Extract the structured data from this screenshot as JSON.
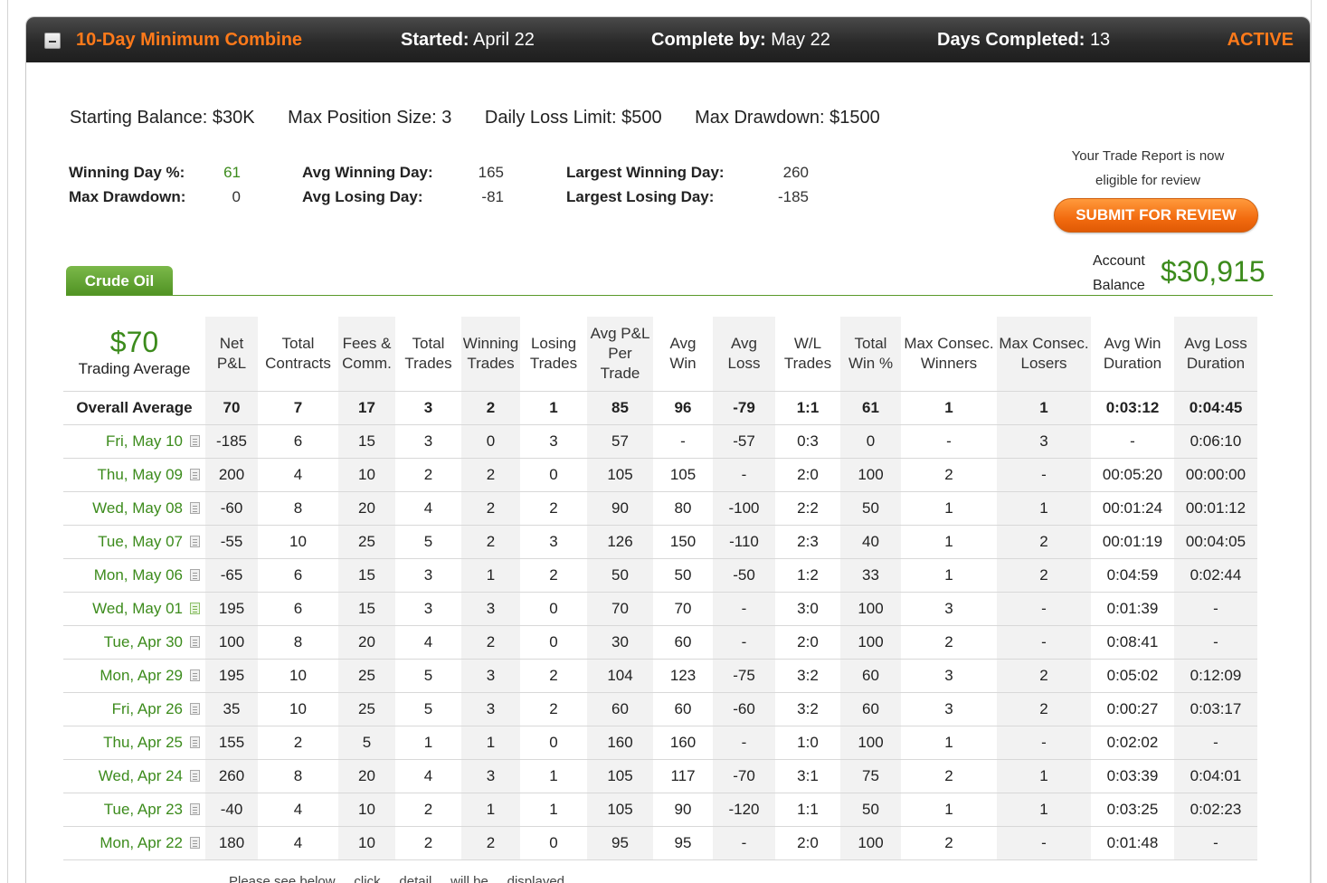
{
  "header": {
    "title": "10-Day Minimum Combine",
    "started_label": "Started:",
    "started_value": "April 22",
    "complete_label": "Complete by:",
    "complete_value": "May 22",
    "days_label": "Days Completed:",
    "days_value": "13",
    "status": "ACTIVE"
  },
  "rules": {
    "starting_balance": "Starting Balance: $30K",
    "max_position": "Max Position Size: 3",
    "daily_loss": "Daily Loss Limit: $500",
    "max_drawdown": "Max Drawdown: $1500"
  },
  "stats": {
    "winning_day_pct_label": "Winning Day %:",
    "winning_day_pct_value": "61",
    "max_drawdown_label": "Max Drawdown:",
    "max_drawdown_value": "0",
    "avg_winning_day_label": "Avg Winning Day:",
    "avg_winning_day_value": "165",
    "avg_losing_day_label": "Avg Losing Day:",
    "avg_losing_day_value": "-81",
    "largest_winning_day_label": "Largest Winning Day:",
    "largest_winning_day_value": "260",
    "largest_losing_day_label": "Largest Losing Day:",
    "largest_losing_day_value": "-185"
  },
  "review": {
    "note_line1": "Your Trade Report is now",
    "note_line2": "eligible for review",
    "submit_label": "SUBMIT FOR REVIEW"
  },
  "account": {
    "label_line1": "Account",
    "label_line2": "Balance",
    "value": "$30,915"
  },
  "tabs": [
    {
      "label": "Crude Oil"
    }
  ],
  "summary": {
    "trading_average_value": "$70",
    "trading_average_label": "Trading Average"
  },
  "columns": [
    {
      "l1": "Net",
      "l2": "P&L"
    },
    {
      "l1": "Total",
      "l2": "Contracts"
    },
    {
      "l1": "Fees &",
      "l2": "Comm."
    },
    {
      "l1": "Total",
      "l2": "Trades"
    },
    {
      "l1": "Winning",
      "l2": "Trades"
    },
    {
      "l1": "Losing",
      "l2": "Trades"
    },
    {
      "l1": "Avg P&L",
      "l2": "Per",
      "l3": "Trade"
    },
    {
      "l1": "Avg",
      "l2": "Win"
    },
    {
      "l1": "Avg",
      "l2": "Loss"
    },
    {
      "l1": "W/L",
      "l2": "Trades"
    },
    {
      "l1": "Total",
      "l2": "Win %"
    },
    {
      "l1": "Max Consec.",
      "l2": "Winners"
    },
    {
      "l1": "Max Consec.",
      "l2": "Losers"
    },
    {
      "l1": "Avg Win",
      "l2": "Duration"
    },
    {
      "l1": "Avg Loss",
      "l2": "Duration"
    }
  ],
  "overall": {
    "label": "Overall Average",
    "values": [
      "70",
      "7",
      "17",
      "3",
      "2",
      "1",
      "85",
      "96",
      "-79",
      "1:1",
      "61",
      "1",
      "1",
      "0:03:12",
      "0:04:45"
    ]
  },
  "rows": [
    {
      "date": "Fri, May 10",
      "icon": "report-icon",
      "values": [
        "-185",
        "6",
        "15",
        "3",
        "0",
        "3",
        "57",
        "-",
        "-57",
        "0:3",
        "0",
        "-",
        "3",
        "-",
        "0:06:10"
      ]
    },
    {
      "date": "Thu, May 09",
      "icon": "report-icon",
      "values": [
        "200",
        "4",
        "10",
        "2",
        "2",
        "0",
        "105",
        "105",
        "-",
        "2:0",
        "100",
        "2",
        "-",
        "00:05:20",
        "00:00:00"
      ]
    },
    {
      "date": "Wed, May 08",
      "icon": "report-icon",
      "values": [
        "-60",
        "8",
        "20",
        "4",
        "2",
        "2",
        "90",
        "80",
        "-100",
        "2:2",
        "50",
        "1",
        "1",
        "00:01:24",
        "00:01:12"
      ]
    },
    {
      "date": "Tue, May 07",
      "icon": "report-icon",
      "values": [
        "-55",
        "10",
        "25",
        "5",
        "2",
        "3",
        "126",
        "150",
        "-110",
        "2:3",
        "40",
        "1",
        "2",
        "00:01:19",
        "00:04:05"
      ]
    },
    {
      "date": "Mon, May 06",
      "icon": "report-icon",
      "values": [
        "-65",
        "6",
        "15",
        "3",
        "1",
        "2",
        "50",
        "50",
        "-50",
        "1:2",
        "33",
        "1",
        "2",
        "0:04:59",
        "0:02:44"
      ]
    },
    {
      "date": "Wed, May 01",
      "icon": "report-icon-green",
      "values": [
        "195",
        "6",
        "15",
        "3",
        "3",
        "0",
        "70",
        "70",
        "-",
        "3:0",
        "100",
        "3",
        "-",
        "0:01:39",
        "-"
      ]
    },
    {
      "date": "Tue, Apr 30",
      "icon": "report-icon",
      "values": [
        "100",
        "8",
        "20",
        "4",
        "2",
        "0",
        "30",
        "60",
        "-",
        "2:0",
        "100",
        "2",
        "-",
        "0:08:41",
        "-"
      ]
    },
    {
      "date": "Mon, Apr 29",
      "icon": "report-icon",
      "values": [
        "195",
        "10",
        "25",
        "5",
        "3",
        "2",
        "104",
        "123",
        "-75",
        "3:2",
        "60",
        "3",
        "2",
        "0:05:02",
        "0:12:09"
      ]
    },
    {
      "date": "Fri, Apr 26",
      "icon": "report-icon",
      "values": [
        "35",
        "10",
        "25",
        "5",
        "3",
        "2",
        "60",
        "60",
        "-60",
        "3:2",
        "60",
        "3",
        "2",
        "0:00:27",
        "0:03:17"
      ]
    },
    {
      "date": "Thu, Apr 25",
      "icon": "report-icon",
      "values": [
        "155",
        "2",
        "5",
        "1",
        "1",
        "0",
        "160",
        "160",
        "-",
        "1:0",
        "100",
        "1",
        "-",
        "0:02:02",
        "-"
      ]
    },
    {
      "date": "Wed, Apr 24",
      "icon": "report-icon",
      "values": [
        "260",
        "8",
        "20",
        "4",
        "3",
        "1",
        "105",
        "117",
        "-70",
        "3:1",
        "75",
        "2",
        "1",
        "0:03:39",
        "0:04:01"
      ]
    },
    {
      "date": "Tue, Apr 23",
      "icon": "report-icon",
      "values": [
        "-40",
        "4",
        "10",
        "2",
        "1",
        "1",
        "105",
        "90",
        "-120",
        "1:1",
        "50",
        "1",
        "1",
        "0:03:25",
        "0:02:23"
      ]
    },
    {
      "date": "Mon, Apr 22",
      "icon": "report-icon",
      "values": [
        "180",
        "4",
        "10",
        "2",
        "2",
        "0",
        "95",
        "95",
        "-",
        "2:0",
        "100",
        "2",
        "-",
        "0:01:48",
        "-"
      ]
    }
  ],
  "colors": {
    "accent_orange": "#ff7a1a",
    "green": "#3c8b1c",
    "red": "#d21d1d"
  },
  "footer": {
    "note": "Please see below ... click ... detail ... will be ... displayed"
  }
}
